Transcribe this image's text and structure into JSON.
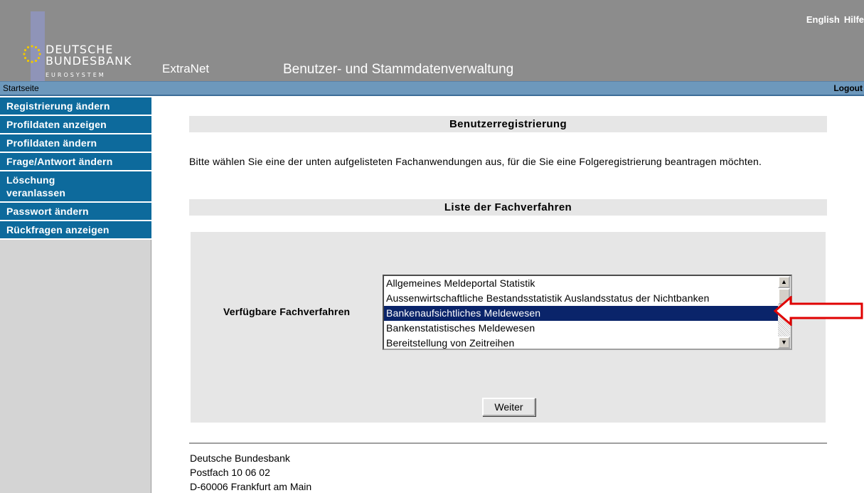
{
  "header": {
    "logo_line1": "DEUTSCHE",
    "logo_line2": "BUNDESBANK",
    "logo_sub": "EUROSYSTEM",
    "app_name": "ExtraNet",
    "app_title": "Benutzer- und Stammdatenverwaltung",
    "lang_english": "English",
    "lang_help": "Hilfe"
  },
  "navbar": {
    "home": "Startseite",
    "logout": "Logout"
  },
  "sidebar": {
    "items": [
      {
        "label": "Registrierung ändern"
      },
      {
        "label": "Profildaten anzeigen"
      },
      {
        "label": "Profildaten ändern"
      },
      {
        "label": "Frage/Antwort ändern"
      },
      {
        "label": "Löschung veranlassen"
      },
      {
        "label": "Passwort ändern"
      },
      {
        "label": "Rückfragen anzeigen"
      }
    ]
  },
  "main": {
    "section1_title": "Benutzerregistrierung",
    "intro": "Bitte wählen Sie eine der unten aufgelisteten Fachanwendungen aus, für die Sie eine Folgeregistrierung beantragen möchten.",
    "section2_title": "Liste der Fachverfahren",
    "select_label": "Verfügbare Fachverfahren",
    "options": [
      "Allgemeines Meldeportal Statistik",
      "Aussenwirtschaftliche Bestandsstatistik Auslandsstatus der Nichtbanken",
      "Bankenaufsichtliches Meldewesen",
      "Bankenstatistisches Meldewesen",
      "Bereitstellung von Zeitreihen"
    ],
    "selected_option": "Bankenaufsichtliches Meldewesen",
    "submit_label": "Weiter"
  },
  "footer": {
    "line1": "Deutsche Bundesbank",
    "line2": "Postfach 10 06 02",
    "line3": "D-60006 Frankfurt am Main"
  },
  "colors": {
    "header_bg": "#8c8c8c",
    "navbar_bg": "#6d98bc",
    "sidebar_item_bg": "#0d6a9c",
    "selection_bg": "#0a246a",
    "annotation_arrow": "#e00000"
  }
}
